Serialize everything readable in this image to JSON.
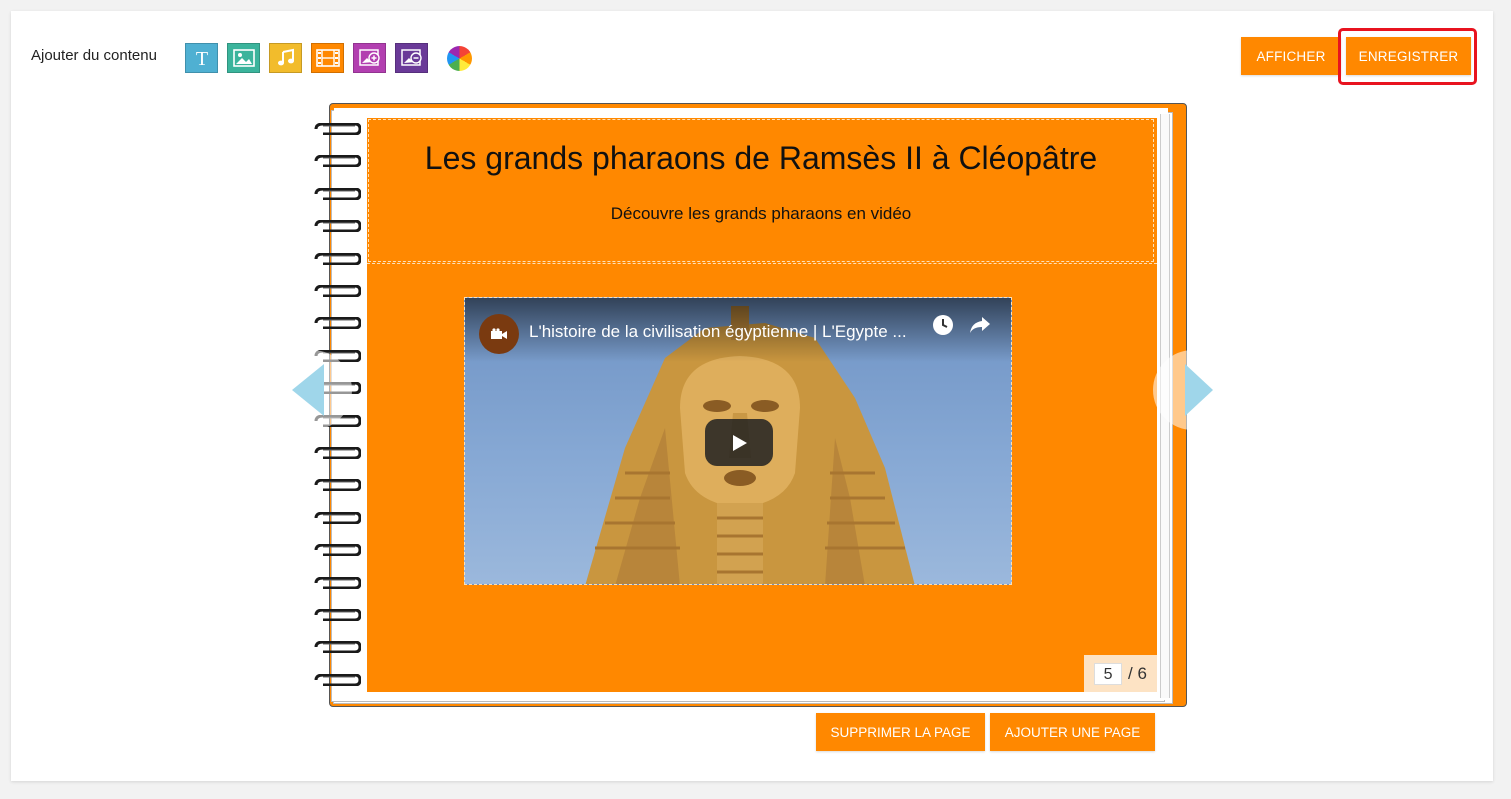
{
  "toolbar": {
    "label": "Ajouter du contenu",
    "tools": [
      {
        "name": "text-tool",
        "icon": "text-icon",
        "color": "#4fb0d2"
      },
      {
        "name": "image-tool",
        "icon": "image-icon",
        "color": "#3bb49c"
      },
      {
        "name": "audio-tool",
        "icon": "music-icon",
        "color": "#f2bc2c"
      },
      {
        "name": "video-tool",
        "icon": "film-icon",
        "color": "#ff8800"
      },
      {
        "name": "add-image-tool",
        "icon": "add-image-icon",
        "color": "#b23fb0"
      },
      {
        "name": "remove-image-tool",
        "icon": "remove-image-icon",
        "color": "#6a3a98"
      }
    ],
    "color_picker_icon": "color-wheel-icon"
  },
  "actions": {
    "afficher": "AFFICHER",
    "enregistrer": "ENREGISTRER"
  },
  "page": {
    "title": "Les grands pharaons de Ramsès II à Cléopâtre",
    "subtitle": "Découvre les grands pharaons en vidéo",
    "video_title": "L'histoire de la civilisation égyptienne | L'Egypte ...",
    "current": "5",
    "total": "/ 6"
  },
  "bottom_actions": {
    "delete_page": "SUPPRIMER LA PAGE",
    "add_page": "AJOUTER UNE PAGE"
  },
  "colors": {
    "accent": "#ff8800",
    "highlight": "#e8131f",
    "nav_arrow": "#9fd6ea"
  }
}
